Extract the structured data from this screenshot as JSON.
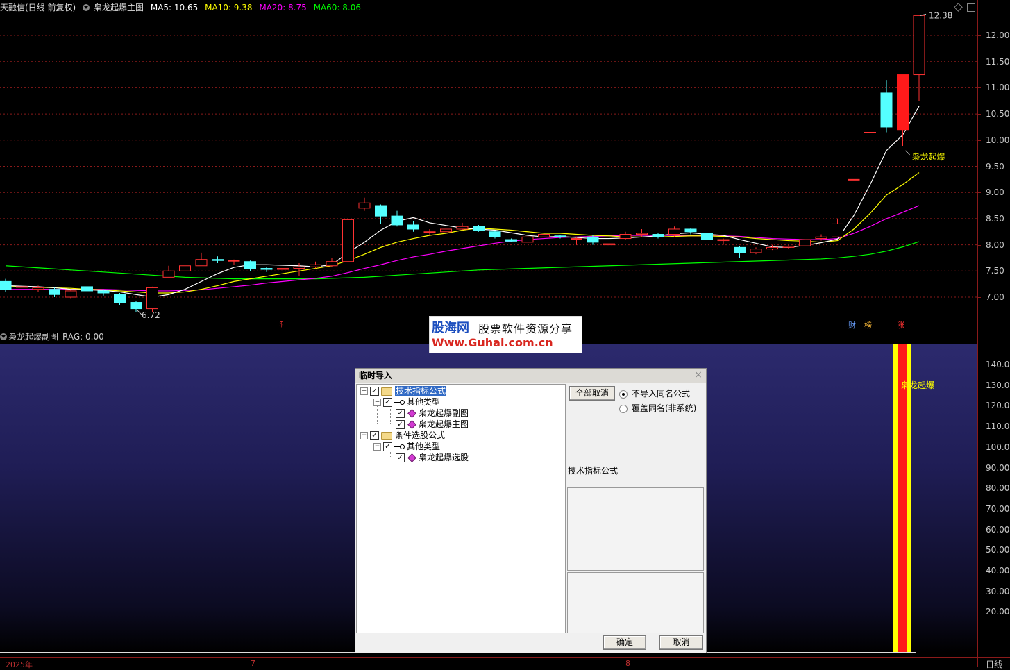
{
  "header": {
    "title": "天融信(日线 前复权)",
    "indicator_name": "枭龙起爆主图",
    "ma5": "MA5: 10.65",
    "ma10": "MA10: 9.38",
    "ma20": "MA20: 8.75",
    "ma60": "MA60: 8.06"
  },
  "sub_header": {
    "indicator_name": "枭龙起爆副图",
    "rag": "RAG: 0.00"
  },
  "colors": {
    "up": "#ff3232",
    "down": "#54ffff",
    "ma5": "#ffffff",
    "ma10": "#ffff00",
    "ma20": "#ff00ff",
    "ma60": "#00ff00",
    "grid": "#8a1a1a"
  },
  "price_axis": [
    "12.00",
    "11.50",
    "11.00",
    "10.50",
    "10.00",
    "9.50",
    "9.00",
    "8.50",
    "8.00",
    "7.50",
    "7.00"
  ],
  "sub_axis": [
    "140.00",
    "130.00",
    "120.00",
    "110.00",
    "100.00",
    "90.00",
    "80.00",
    "70.00",
    "60.00",
    "50.00",
    "40.00",
    "30.00",
    "20.00"
  ],
  "annotations": {
    "high": "12.38",
    "low": "6.72",
    "signal_main": "枭龙起爆",
    "signal_sub": "枭龙起爆"
  },
  "badges": {
    "dollar": "$",
    "cai": "财",
    "bang": "榜",
    "zhang": "涨"
  },
  "time_axis": {
    "y2025": "2025年",
    "m7": "7",
    "m8": "8",
    "period": "日线"
  },
  "watermark": {
    "brand": "股海网",
    "slogan": "股票软件资源分享",
    "url": "Www.Guhai.com.cn"
  },
  "dialog": {
    "title": "临时导入",
    "close": "×",
    "tree": [
      {
        "label": "技术指标公式",
        "checked": true
      },
      {
        "label": "其他类型",
        "checked": true
      },
      {
        "label": "枭龙起爆副图",
        "checked": true
      },
      {
        "label": "枭龙起爆主图",
        "checked": true
      },
      {
        "label": "条件选股公式",
        "checked": true
      },
      {
        "label": "其他类型",
        "checked": true
      },
      {
        "label": "枭龙起爆选股",
        "checked": true
      }
    ],
    "cancel_all": "全部取消",
    "radio_no_import": "不导入同名公式",
    "radio_overwrite": "覆盖同名(非系统)",
    "info_label": "技术指标公式",
    "ok": "确定",
    "cancel": "取消"
  },
  "chart_data": {
    "type": "candlestick",
    "ylim": [
      6.6,
      12.6
    ],
    "candles": [
      {
        "o": 7.3,
        "c": 7.15,
        "h": 7.35,
        "l": 7.1
      },
      {
        "o": 7.2,
        "c": 7.2,
        "h": 7.25,
        "l": 7.15
      },
      {
        "o": 7.15,
        "c": 7.18,
        "h": 7.22,
        "l": 7.1
      },
      {
        "o": 7.15,
        "c": 7.05,
        "h": 7.18,
        "l": 7.0
      },
      {
        "o": 7.0,
        "c": 7.12,
        "h": 7.15,
        "l": 6.98
      },
      {
        "o": 7.2,
        "c": 7.12,
        "h": 7.22,
        "l": 7.08
      },
      {
        "o": 7.12,
        "c": 7.08,
        "h": 7.15,
        "l": 7.03
      },
      {
        "o": 7.05,
        "c": 6.9,
        "h": 7.08,
        "l": 6.85
      },
      {
        "o": 6.9,
        "c": 6.78,
        "h": 6.92,
        "l": 6.72
      },
      {
        "o": 6.78,
        "c": 7.18,
        "h": 7.2,
        "l": 6.72
      },
      {
        "o": 7.38,
        "c": 7.5,
        "h": 7.6,
        "l": 7.38
      },
      {
        "o": 7.5,
        "c": 7.6,
        "h": 7.62,
        "l": 7.45
      },
      {
        "o": 7.6,
        "c": 7.72,
        "h": 7.85,
        "l": 7.6
      },
      {
        "o": 7.72,
        "c": 7.7,
        "h": 7.78,
        "l": 7.65
      },
      {
        "o": 7.7,
        "c": 7.7,
        "h": 7.72,
        "l": 7.62
      },
      {
        "o": 7.68,
        "c": 7.55,
        "h": 7.7,
        "l": 7.5
      },
      {
        "o": 7.55,
        "c": 7.53,
        "h": 7.58,
        "l": 7.48
      },
      {
        "o": 7.53,
        "c": 7.55,
        "h": 7.6,
        "l": 7.45
      },
      {
        "o": 7.55,
        "c": 7.58,
        "h": 7.65,
        "l": 7.4
      },
      {
        "o": 7.58,
        "c": 7.62,
        "h": 7.68,
        "l": 7.55
      },
      {
        "o": 7.6,
        "c": 7.68,
        "h": 7.75,
        "l": 7.58
      },
      {
        "o": 7.68,
        "c": 8.48,
        "h": 8.5,
        "l": 7.65
      },
      {
        "o": 8.7,
        "c": 8.8,
        "h": 8.9,
        "l": 8.65
      },
      {
        "o": 8.75,
        "c": 8.55,
        "h": 8.77,
        "l": 8.4
      },
      {
        "o": 8.55,
        "c": 8.38,
        "h": 8.65,
        "l": 8.35
      },
      {
        "o": 8.38,
        "c": 8.3,
        "h": 8.45,
        "l": 8.25
      },
      {
        "o": 8.25,
        "c": 8.25,
        "h": 8.3,
        "l": 8.18
      },
      {
        "o": 8.25,
        "c": 8.3,
        "h": 8.35,
        "l": 8.2
      },
      {
        "o": 8.3,
        "c": 8.35,
        "h": 8.42,
        "l": 8.28
      },
      {
        "o": 8.35,
        "c": 8.28,
        "h": 8.38,
        "l": 8.25
      },
      {
        "o": 8.25,
        "c": 8.15,
        "h": 8.27,
        "l": 8.12
      },
      {
        "o": 8.1,
        "c": 8.07,
        "h": 8.12,
        "l": 8.05
      },
      {
        "o": 8.05,
        "c": 8.15,
        "h": 8.15,
        "l": 8.05
      },
      {
        "o": 8.15,
        "c": 8.2,
        "h": 8.22,
        "l": 8.12
      },
      {
        "o": 8.17,
        "c": 8.15,
        "h": 8.18,
        "l": 8.12
      },
      {
        "o": 8.12,
        "c": 8.12,
        "h": 8.15,
        "l": 8.0
      },
      {
        "o": 8.15,
        "c": 8.05,
        "h": 8.18,
        "l": 8.0
      },
      {
        "o": 8.0,
        "c": 8.02,
        "h": 8.05,
        "l": 7.98
      },
      {
        "o": 8.12,
        "c": 8.2,
        "h": 8.25,
        "l": 8.1
      },
      {
        "o": 8.2,
        "c": 8.22,
        "h": 8.3,
        "l": 8.15
      },
      {
        "o": 8.2,
        "c": 8.15,
        "h": 8.22,
        "l": 8.12
      },
      {
        "o": 8.2,
        "c": 8.3,
        "h": 8.35,
        "l": 8.15
      },
      {
        "o": 8.3,
        "c": 8.25,
        "h": 8.32,
        "l": 8.2
      },
      {
        "o": 8.22,
        "c": 8.1,
        "h": 8.25,
        "l": 8.05
      },
      {
        "o": 8.08,
        "c": 8.1,
        "h": 8.12,
        "l": 8.0
      },
      {
        "o": 7.95,
        "c": 7.85,
        "h": 7.98,
        "l": 7.75
      },
      {
        "o": 7.85,
        "c": 7.92,
        "h": 7.95,
        "l": 7.82
      },
      {
        "o": 7.92,
        "c": 7.95,
        "h": 8.0,
        "l": 7.9
      },
      {
        "o": 7.95,
        "c": 7.97,
        "h": 8.0,
        "l": 7.92
      },
      {
        "o": 7.98,
        "c": 8.1,
        "h": 8.12,
        "l": 7.95
      },
      {
        "o": 8.12,
        "c": 8.15,
        "h": 8.2,
        "l": 8.08
      },
      {
        "o": 8.15,
        "c": 8.4,
        "h": 8.5,
        "l": 8.15
      },
      {
        "o": 9.25,
        "c": 9.25,
        "h": 9.25,
        "l": 9.25
      },
      {
        "o": 10.15,
        "c": 10.15,
        "h": 10.15,
        "l": 10.0
      },
      {
        "o": 10.9,
        "c": 10.25,
        "h": 11.15,
        "l": 10.15
      },
      {
        "o": 10.2,
        "c": 11.25,
        "h": 11.25,
        "l": 9.88
      },
      {
        "o": 11.25,
        "c": 12.38,
        "h": 12.38,
        "l": 10.75
      }
    ],
    "ma5": [
      7.22,
      7.21,
      7.2,
      7.18,
      7.15,
      7.14,
      7.13,
      7.1,
      7.05,
      7.0,
      7.05,
      7.15,
      7.3,
      7.45,
      7.57,
      7.62,
      7.62,
      7.61,
      7.6,
      7.58,
      7.62,
      7.85,
      8.05,
      8.28,
      8.45,
      8.52,
      8.42,
      8.37,
      8.32,
      8.3,
      8.28,
      8.23,
      8.18,
      8.15,
      8.16,
      8.14,
      8.12,
      8.12,
      8.13,
      8.15,
      8.17,
      8.21,
      8.23,
      8.2,
      8.18,
      8.1,
      8.03,
      7.96,
      7.95,
      7.99,
      8.04,
      8.11,
      8.56,
      9.15,
      9.8,
      10.1,
      10.65
    ],
    "ma10": [
      7.2,
      7.2,
      7.19,
      7.18,
      7.17,
      7.15,
      7.14,
      7.12,
      7.1,
      7.08,
      7.08,
      7.1,
      7.15,
      7.22,
      7.3,
      7.35,
      7.4,
      7.45,
      7.5,
      7.55,
      7.6,
      7.7,
      7.82,
      7.95,
      8.05,
      8.12,
      8.18,
      8.22,
      8.28,
      8.32,
      8.3,
      8.28,
      8.25,
      8.22,
      8.22,
      8.2,
      8.18,
      8.17,
      8.15,
      8.15,
      8.15,
      8.16,
      8.17,
      8.17,
      8.16,
      8.15,
      8.12,
      8.1,
      8.08,
      8.07,
      8.05,
      8.08,
      8.3,
      8.6,
      8.95,
      9.15,
      9.38
    ],
    "ma20": [
      7.15,
      7.15,
      7.15,
      7.15,
      7.15,
      7.15,
      7.15,
      7.14,
      7.13,
      7.12,
      7.12,
      7.13,
      7.14,
      7.17,
      7.2,
      7.23,
      7.27,
      7.3,
      7.33,
      7.36,
      7.4,
      7.47,
      7.55,
      7.62,
      7.7,
      7.77,
      7.82,
      7.88,
      7.93,
      7.98,
      8.03,
      8.07,
      8.1,
      8.12,
      8.14,
      8.15,
      8.16,
      8.17,
      8.18,
      8.18,
      8.18,
      8.18,
      8.17,
      8.17,
      8.17,
      8.16,
      8.14,
      8.12,
      8.11,
      8.1,
      8.1,
      8.12,
      8.22,
      8.35,
      8.5,
      8.62,
      8.75
    ],
    "ma60": [
      7.6,
      7.58,
      7.56,
      7.54,
      7.52,
      7.5,
      7.48,
      7.46,
      7.44,
      7.42,
      7.4,
      7.38,
      7.37,
      7.36,
      7.35,
      7.35,
      7.35,
      7.35,
      7.35,
      7.35,
      7.36,
      7.37,
      7.38,
      7.4,
      7.42,
      7.44,
      7.46,
      7.48,
      7.5,
      7.52,
      7.53,
      7.54,
      7.55,
      7.56,
      7.57,
      7.58,
      7.59,
      7.6,
      7.61,
      7.62,
      7.63,
      7.64,
      7.65,
      7.66,
      7.67,
      7.68,
      7.69,
      7.7,
      7.71,
      7.72,
      7.73,
      7.75,
      7.78,
      7.82,
      7.88,
      7.96,
      8.06
    ]
  }
}
